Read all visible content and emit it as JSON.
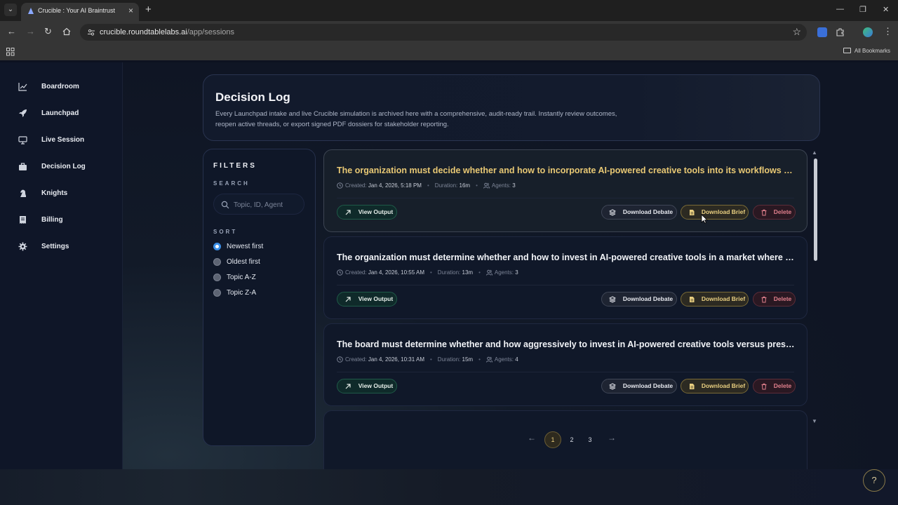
{
  "browser": {
    "tab_title": "Crucible : Your AI Braintrust",
    "url_host": "crucible.roundtablelabs.ai",
    "url_path": "/app/sessions",
    "all_bookmarks": "All Bookmarks"
  },
  "sidebar": {
    "items": [
      {
        "label": "Boardroom",
        "icon": "chart-line-icon"
      },
      {
        "label": "Launchpad",
        "icon": "rocket-icon"
      },
      {
        "label": "Live Session",
        "icon": "monitor-icon"
      },
      {
        "label": "Decision Log",
        "icon": "briefcase-icon"
      },
      {
        "label": "Knights",
        "icon": "chess-knight-icon"
      },
      {
        "label": "Billing",
        "icon": "receipt-icon"
      },
      {
        "label": "Settings",
        "icon": "gear-icon"
      }
    ]
  },
  "header": {
    "title": "Decision Log",
    "description": "Every Launchpad intake and live Crucible simulation is archived here with a comprehensive, audit-ready trail. Instantly review outcomes, reopen active threads, or export signed PDF dossiers for stakeholder reporting."
  },
  "filters": {
    "title": "FILTERS",
    "search_label": "SEARCH",
    "search_placeholder": "Topic, ID, Agent",
    "search_value": "",
    "sort_label": "SORT",
    "sort_options": [
      "Newest first",
      "Oldest first",
      "Topic A-Z",
      "Topic Z-A"
    ],
    "sort_selected": "Newest first"
  },
  "labels": {
    "created": "Created:",
    "duration": "Duration:",
    "agents": "Agents:",
    "view_output": "View Output",
    "download_debate": "Download Debate",
    "download_brief": "Download Brief",
    "delete": "Delete"
  },
  "sessions": [
    {
      "title": "The organization must decide whether and how to incorporate AI-powered creative tools into its workflows vers...",
      "created": "Jan 4, 2026, 5:18 PM",
      "duration": "16m",
      "agents": "3"
    },
    {
      "title": "The organization must determine whether and how to invest in AI-powered creative tools in a market where co...",
      "created": "Jan 4, 2026, 10:55 AM",
      "duration": "13m",
      "agents": "3"
    },
    {
      "title": "The board must determine whether and how aggressively to invest in AI-powered creative tools versus preservi...",
      "created": "Jan 4, 2026, 10:31 AM",
      "duration": "15m",
      "agents": "4"
    }
  ],
  "pagination": {
    "pages": [
      "1",
      "2",
      "3"
    ],
    "current": "1"
  },
  "colors": {
    "accent_gold": "#e8c874",
    "accent_green": "#1f5a48",
    "danger": "#e2808d",
    "radio_checked": "#3b8fe8"
  }
}
